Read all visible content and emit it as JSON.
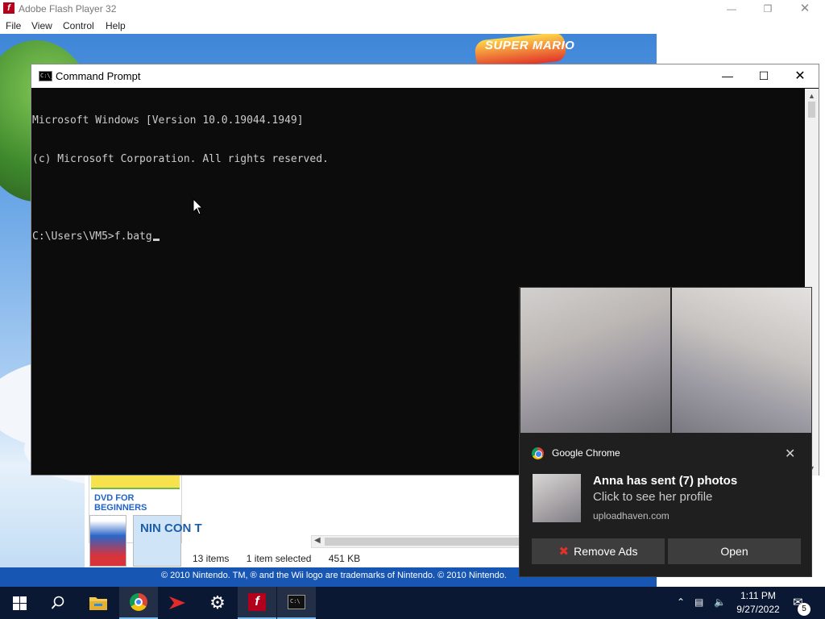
{
  "flash": {
    "title": "Adobe Flash Player 32",
    "menu": [
      "File",
      "View",
      "Control",
      "Help"
    ],
    "logo_text": "SUPER MARIO",
    "dvd_label": "DVD FOR BEGINNERS",
    "thumb2_text": "NIN CON T",
    "status": {
      "items": "13 items",
      "selected": "1 item selected",
      "size": "451 KB"
    },
    "footer": "© 2010 Nintendo. TM, ® and the Wii logo are trademarks of Nintendo. © 2010 Nintendo."
  },
  "cmd": {
    "title": "Command Prompt",
    "lines": [
      "Microsoft Windows [Version 10.0.19044.1949]",
      "(c) Microsoft Corporation. All rights reserved.",
      "",
      "C:\\Users\\VM5>f.batg"
    ]
  },
  "notification": {
    "app": "Google Chrome",
    "title": "Anna has sent (7) photos",
    "text": "Click to see her profile",
    "source": "uploadhaven.com",
    "buttons": {
      "remove": "Remove Ads",
      "open": "Open"
    }
  },
  "taskbar": {
    "time": "1:11 PM",
    "date": "9/27/2022",
    "notification_count": "5",
    "pinned": [
      "start-icon",
      "search-icon",
      "file-explorer-icon",
      "chrome-icon",
      "media-player-icon",
      "settings-icon",
      "flash-player-icon",
      "command-prompt-icon"
    ]
  }
}
